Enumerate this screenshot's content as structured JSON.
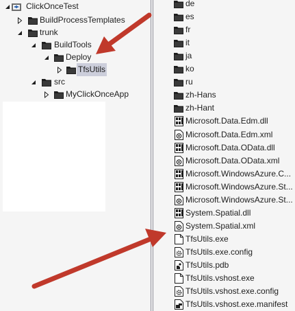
{
  "tree": [
    {
      "label": "ClickOnceTest",
      "icon": "solution-icon",
      "toggle": "expanded"
    },
    {
      "label": "BuildProcessTemplates",
      "icon": "folder-icon",
      "toggle": "collapsed"
    },
    {
      "label": "trunk",
      "icon": "folder-icon",
      "toggle": "expanded"
    },
    {
      "label": "BuildTools",
      "icon": "folder-icon",
      "toggle": "expanded"
    },
    {
      "label": "Deploy",
      "icon": "folder-icon",
      "toggle": "expanded"
    },
    {
      "label": "TfsUtils",
      "icon": "folder-icon",
      "toggle": "collapsed"
    },
    {
      "label": "src",
      "icon": "folder-icon",
      "toggle": "expanded"
    },
    {
      "label": "MyClickOnceApp",
      "icon": "folder-icon",
      "toggle": "collapsed"
    }
  ],
  "files": [
    {
      "label": "de",
      "icon": "folder-icon"
    },
    {
      "label": "es",
      "icon": "folder-icon"
    },
    {
      "label": "fr",
      "icon": "folder-icon"
    },
    {
      "label": "it",
      "icon": "folder-icon"
    },
    {
      "label": "ja",
      "icon": "folder-icon"
    },
    {
      "label": "ko",
      "icon": "folder-icon"
    },
    {
      "label": "ru",
      "icon": "folder-icon"
    },
    {
      "label": "zh-Hans",
      "icon": "folder-icon"
    },
    {
      "label": "zh-Hant",
      "icon": "folder-icon"
    },
    {
      "label": "Microsoft.Data.Edm.dll",
      "icon": "dll-icon"
    },
    {
      "label": "Microsoft.Data.Edm.xml",
      "icon": "xml-icon"
    },
    {
      "label": "Microsoft.Data.OData.dll",
      "icon": "dll-icon"
    },
    {
      "label": "Microsoft.Data.OData.xml",
      "icon": "xml-icon"
    },
    {
      "label": "Microsoft.WindowsAzure.C...",
      "icon": "dll-icon"
    },
    {
      "label": "Microsoft.WindowsAzure.St...",
      "icon": "dll-icon"
    },
    {
      "label": "Microsoft.WindowsAzure.St...",
      "icon": "xml-icon"
    },
    {
      "label": "System.Spatial.dll",
      "icon": "dll-icon"
    },
    {
      "label": "System.Spatial.xml",
      "icon": "xml-icon"
    },
    {
      "label": "TfsUtils.exe",
      "icon": "file-icon"
    },
    {
      "label": "TfsUtils.exe.config",
      "icon": "config-icon"
    },
    {
      "label": "TfsUtils.pdb",
      "icon": "pdb-icon"
    },
    {
      "label": "TfsUtils.vshost.exe",
      "icon": "file-icon"
    },
    {
      "label": "TfsUtils.vshost.exe.config",
      "icon": "config-icon"
    },
    {
      "label": "TfsUtils.vshost.exe.manifest",
      "icon": "manifest-icon"
    }
  ],
  "colors": {
    "arrow": "#c0392b",
    "selection": "#cccedb",
    "pane": "#f5f5f5",
    "splitter_line": "#9a9aa0"
  }
}
